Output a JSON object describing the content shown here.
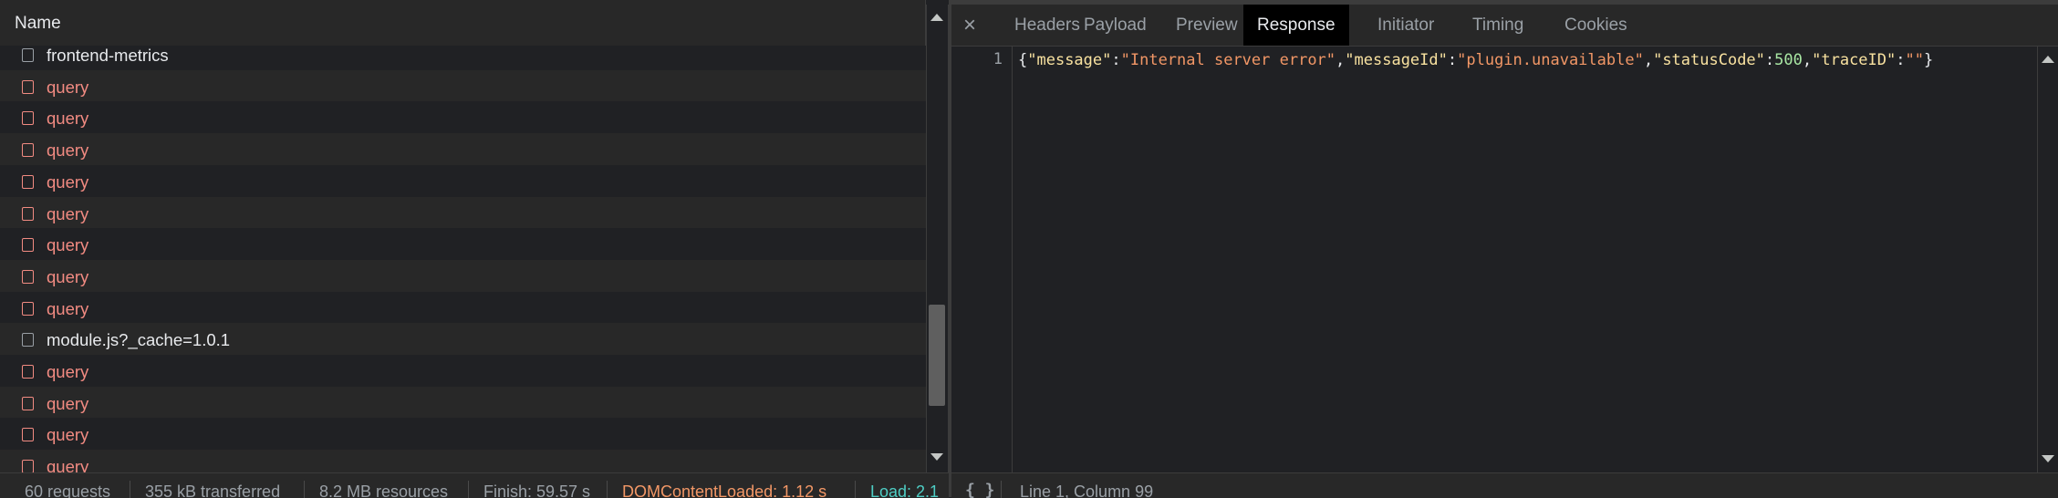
{
  "list_header": {
    "name_column": "Name"
  },
  "requests": [
    {
      "label": "frontend-metrics",
      "status": "ok"
    },
    {
      "label": "query",
      "status": "error"
    },
    {
      "label": "query",
      "status": "error"
    },
    {
      "label": "query",
      "status": "error"
    },
    {
      "label": "query",
      "status": "error"
    },
    {
      "label": "query",
      "status": "error"
    },
    {
      "label": "query",
      "status": "error"
    },
    {
      "label": "query",
      "status": "error"
    },
    {
      "label": "query",
      "status": "error"
    },
    {
      "label": "module.js?_cache=1.0.1",
      "status": "ok"
    },
    {
      "label": "query",
      "status": "error"
    },
    {
      "label": "query",
      "status": "error"
    },
    {
      "label": "query",
      "status": "error"
    },
    {
      "label": "query",
      "status": "error"
    }
  ],
  "details": {
    "close_label": "×",
    "tabs": [
      {
        "label": "Headers",
        "active": false
      },
      {
        "label": "Payload",
        "active": false
      },
      {
        "label": "Preview",
        "active": false
      },
      {
        "label": "Response",
        "active": true
      },
      {
        "label": "Initiator",
        "active": false
      },
      {
        "label": "Timing",
        "active": false
      },
      {
        "label": "Cookies",
        "active": false
      }
    ],
    "response": {
      "line_number": "1",
      "tokens": [
        {
          "t": "{",
          "k": "punc"
        },
        {
          "t": "\"message\"",
          "k": "key"
        },
        {
          "t": ":",
          "k": "punc"
        },
        {
          "t": "\"Internal server error\"",
          "k": "str"
        },
        {
          "t": ",",
          "k": "punc"
        },
        {
          "t": "\"messageId\"",
          "k": "key"
        },
        {
          "t": ":",
          "k": "punc"
        },
        {
          "t": "\"plugin.unavailable\"",
          "k": "str"
        },
        {
          "t": ",",
          "k": "punc"
        },
        {
          "t": "\"statusCode\"",
          "k": "key"
        },
        {
          "t": ":",
          "k": "punc"
        },
        {
          "t": "500",
          "k": "num"
        },
        {
          "t": ",",
          "k": "punc"
        },
        {
          "t": "\"traceID\"",
          "k": "key"
        },
        {
          "t": ":",
          "k": "punc"
        },
        {
          "t": "\"\"",
          "k": "str"
        },
        {
          "t": "}",
          "k": "punc"
        }
      ]
    },
    "status": {
      "braces": "{ }",
      "cursor_position": "Line 1, Column 99"
    }
  },
  "summary": {
    "requests": "60 requests",
    "transferred": "355 kB transferred",
    "resources": "8.2 MB resources",
    "finish": "Finish: 59.57 s",
    "dom_content_loaded": "DOMContentLoaded: 1.12 s",
    "load": "Load: 2.1"
  },
  "colors": {
    "error_text": "#f28b82",
    "dom_content_loaded": "#f29766",
    "load": "#4ecdc4",
    "active_tab_bg": "#000000"
  }
}
